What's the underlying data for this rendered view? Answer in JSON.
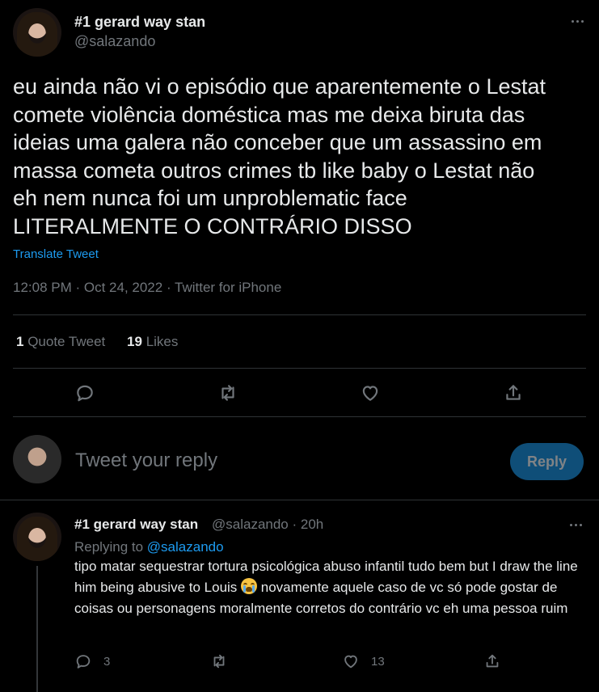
{
  "main_tweet": {
    "display_name": "#1 gerard way stan",
    "handle": "@salazando",
    "text": "eu ainda não vi o episódio que aparentemente o Lestat\ncomete violência doméstica mas me deixa biruta das\nideias uma galera não conceber que um assassino em\nmassa cometa outros crimes tb like baby o Lestat não\neh nem nunca foi um unproblematic face\nLITERALMENTE O CONTRÁRIO DISSO",
    "translate_label": "Translate Tweet",
    "timestamp": "12:08 PM · Oct 24, 2022 · Twitter for iPhone",
    "quote_count": "1",
    "quote_label": "Quote Tweet",
    "likes_count": "19",
    "likes_label": "Likes"
  },
  "composer": {
    "placeholder": "Tweet your reply",
    "reply_button": "Reply"
  },
  "reply_tweet": {
    "display_name": "#1 gerard way stan",
    "handle_time": "@salazando · 20h",
    "replying_prefix": "Replying to",
    "replying_handle": "@salazando",
    "text_part1": "tipo matar sequestrar tortura psicológica abuso infantil tudo bem but I draw the line him being abusive to Louis",
    "text_part2": "novamente aquele caso de vc só pode gostar de coisas ou personagens moralmente corretos do contrário vc eh uma pessoa ruim",
    "reply_count": "3",
    "like_count": "13"
  },
  "icons": {
    "more": "more-horizontal-icon",
    "reply": "reply-icon",
    "retweet": "retweet-icon",
    "like": "heart-icon",
    "share": "share-icon",
    "emoji": "loudly-crying-face-emoji"
  },
  "colors": {
    "background": "#000000",
    "text": "#e7e9ea",
    "muted": "#71767b",
    "accent": "#1d9bf0",
    "divider": "#2f3336",
    "reply_button_disabled": "#0f4e78"
  }
}
